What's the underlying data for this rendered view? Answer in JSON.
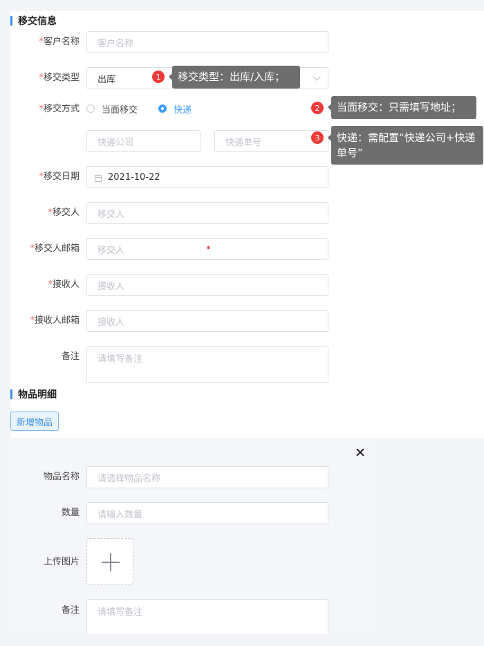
{
  "section1": {
    "title": "移交信息"
  },
  "form": {
    "customer": {
      "label": "客户名称",
      "placeholder": "客户名称"
    },
    "transfer_type": {
      "label": "移交类型",
      "value": "出库"
    },
    "transfer_method": {
      "label": "移交方式",
      "options": [
        "当面移交",
        "快递"
      ],
      "selected": "快递"
    },
    "express_company": {
      "placeholder": "快递公司"
    },
    "express_no": {
      "placeholder": "快递单号"
    },
    "transfer_date": {
      "label": "移交日期",
      "value": "2021-10-22"
    },
    "transferor": {
      "label": "移交人",
      "placeholder": "移交人"
    },
    "transferor_email": {
      "label": "移交人邮箱",
      "placeholder": "移交人"
    },
    "receiver": {
      "label": "接收人",
      "placeholder": "接收人"
    },
    "receiver_email": {
      "label": "接收人邮箱",
      "placeholder": "接收人"
    },
    "remark": {
      "label": "备注",
      "placeholder": "请填写备注"
    },
    "required_mark": "*"
  },
  "section2": {
    "title": "物品明细"
  },
  "add_item_button": "新增物品",
  "item": {
    "name": {
      "label": "物品名称",
      "placeholder": "请选择物品名称"
    },
    "qty": {
      "label": "数量",
      "placeholder": "请输入数量"
    },
    "image": {
      "label": "上传图片"
    },
    "remark": {
      "label": "备注",
      "placeholder": "请填写备注"
    }
  },
  "annotations": [
    {
      "num": "1",
      "text": "移交类型：出库/入库；"
    },
    {
      "num": "2",
      "text": "当面移交：只需填写地址；"
    },
    {
      "num": "3",
      "text": "快递：需配置“快递公司+快递单号”"
    }
  ],
  "colors": {
    "accent": "#409eff",
    "required": "#f56c6c",
    "badge": "#f03a3a",
    "tooltip": "#6e6e6e"
  },
  "icons": [
    "calendar-icon",
    "chevron-down-icon",
    "close-icon",
    "plus-icon"
  ]
}
